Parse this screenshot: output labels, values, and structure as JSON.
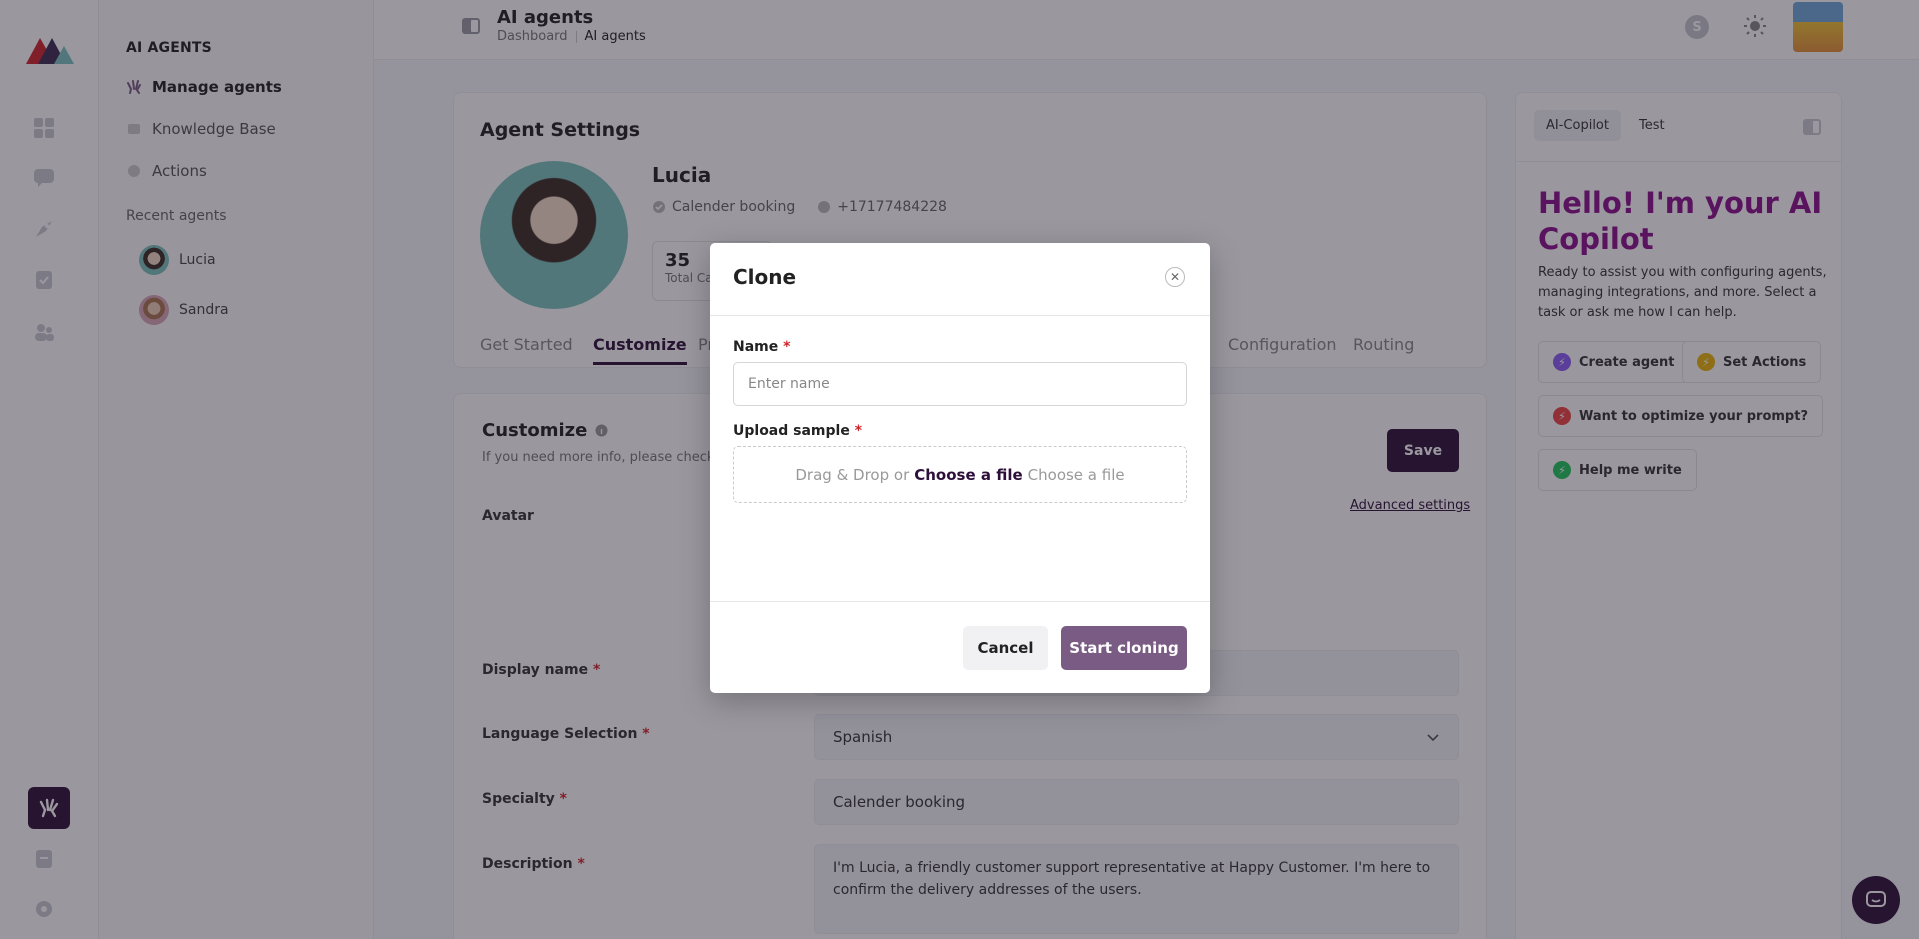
{
  "sidebar": {
    "section_title": "AI AGENTS",
    "items": [
      {
        "label": "Manage agents",
        "icon": "agents-icon"
      },
      {
        "label": "Knowledge Base",
        "icon": "book-icon"
      },
      {
        "label": "Actions",
        "icon": "actions-icon"
      }
    ],
    "recent_title": "Recent agents",
    "recent": [
      {
        "label": "Lucia"
      },
      {
        "label": "Sandra"
      }
    ]
  },
  "header": {
    "title": "AI agents",
    "breadcrumb": [
      "Dashboard",
      "AI agents"
    ],
    "user_initial": "S"
  },
  "agent": {
    "section_heading": "Agent Settings",
    "name": "Lucia",
    "specialty": "Calender booking",
    "phone": "+17177484228",
    "stat_value": "35",
    "stat_label": "Total Calls"
  },
  "tabs": [
    "Get Started",
    "Customize",
    "Pr",
    "Configuration",
    "Routing"
  ],
  "customize": {
    "heading": "Customize",
    "hint": "If you need more info, please check out",
    "save": "Save",
    "advanced": "Advanced settings",
    "avatar_label": "Avatar",
    "display_name_label": "Display name",
    "language_label": "Language Selection",
    "language_value": "Spanish",
    "specialty_label": "Specialty",
    "specialty_value": "Calender booking",
    "description_label": "Description",
    "description_value": "I'm Lucia, a friendly customer support representative at Happy Customer. I'm here to confirm the delivery addresses of the users."
  },
  "copilot": {
    "tabs": [
      "AI-Copilot",
      "Test"
    ],
    "hello": "Hello! I'm your AI Copilot",
    "intro": "Ready to assist you with configuring agents, managing integrations, and more. Select a task or ask me how I can help.",
    "chips": [
      "Create agent",
      "Set Actions",
      "Want to optimize your prompt?",
      "Help me write"
    ]
  },
  "modal": {
    "title": "Clone",
    "name_label": "Name",
    "name_placeholder": "Enter name",
    "upload_label": "Upload sample",
    "drop_prefix": "Drag & Drop or",
    "choose_link": "Choose a file",
    "choose_hint": "Choose a file",
    "cancel": "Cancel",
    "start": "Start cloning"
  },
  "colors": {
    "brand": "#2d0f3a",
    "copilot_heading": "#8b0e8b",
    "start_button": "#7a5b84",
    "required": "#d0242b"
  }
}
